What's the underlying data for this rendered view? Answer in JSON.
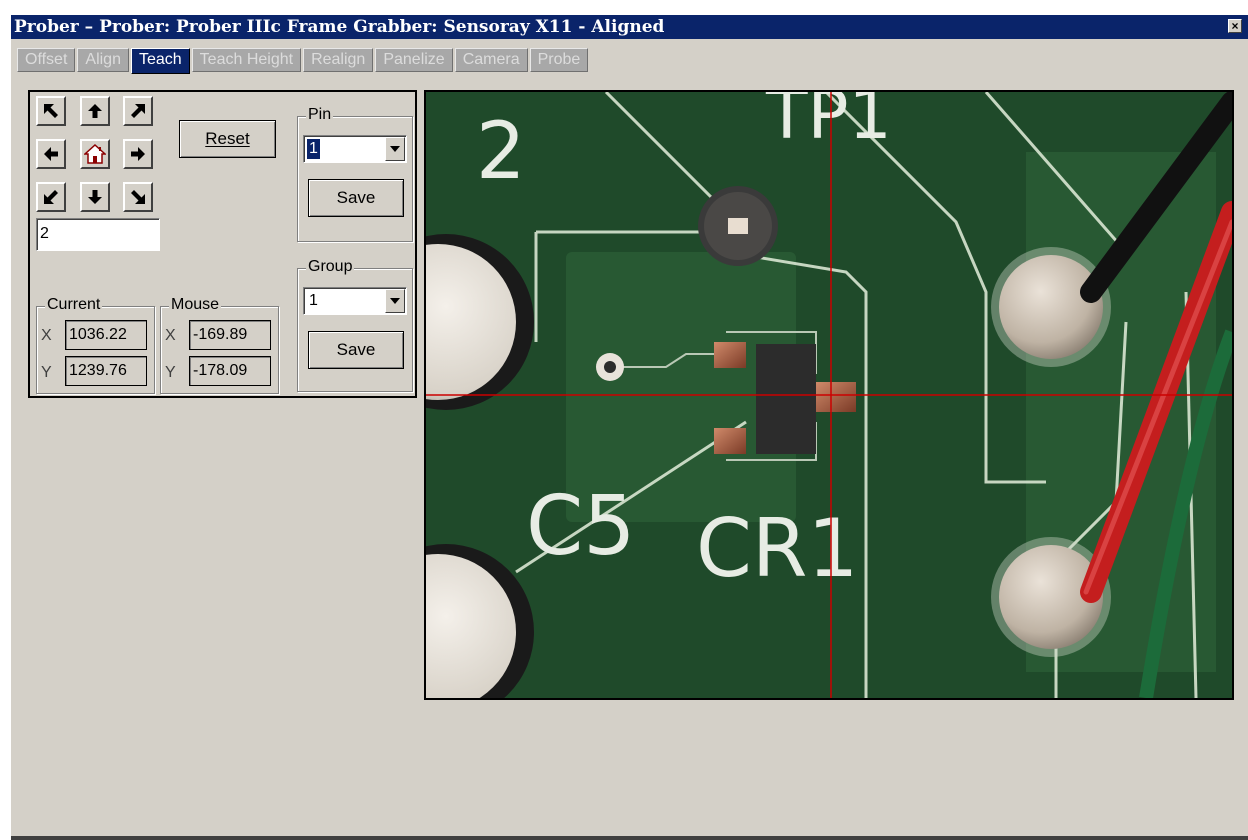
{
  "window": {
    "title": "Prober – Prober: Prober IIIc Frame Grabber: Sensoray X11 - Aligned",
    "close_glyph": "×"
  },
  "tabs": [
    {
      "label": "Offset",
      "active": false
    },
    {
      "label": "Align",
      "active": false
    },
    {
      "label": "Teach",
      "active": true
    },
    {
      "label": "Teach Height",
      "active": false
    },
    {
      "label": "Realign",
      "active": false
    },
    {
      "label": "Panelize",
      "active": false
    },
    {
      "label": "Camera",
      "active": false
    },
    {
      "label": "Probe",
      "active": false
    }
  ],
  "jog": {
    "buttons": [
      "arrow-up-left-icon",
      "arrow-up-icon",
      "arrow-up-right-icon",
      "arrow-left-icon",
      "home-icon",
      "arrow-right-icon",
      "arrow-down-left-icon",
      "arrow-down-icon",
      "arrow-down-right-icon"
    ],
    "step_value": "2"
  },
  "reset_label": "Reset",
  "pin": {
    "label": "Pin",
    "value": "1",
    "save_label": "Save"
  },
  "group": {
    "label": "Group",
    "value": "1",
    "save_label": "Save"
  },
  "current": {
    "label": "Current",
    "x_label": "X",
    "x": "1036.22",
    "y_label": "Y",
    "y": "1239.76"
  },
  "mouse": {
    "label": "Mouse",
    "x_label": "X",
    "x": "-169.89",
    "y_label": "Y",
    "y": "-178.09"
  },
  "camera_view": {
    "board_labels": [
      "2",
      "TP1",
      "C5",
      "CR1"
    ],
    "crosshair_color": "#cc0000",
    "board_color": "#1f4a2a"
  }
}
